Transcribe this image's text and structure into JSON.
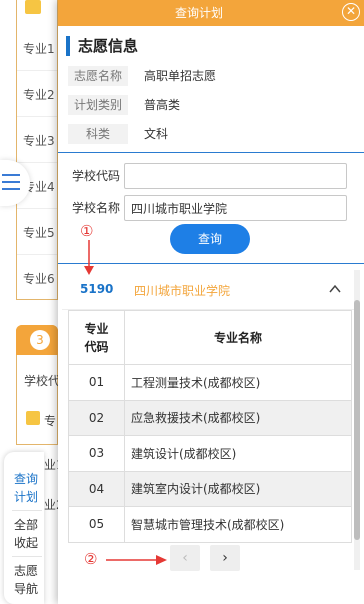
{
  "dialog": {
    "title": "查询计划"
  },
  "wish_info": {
    "section_title": "志愿信息",
    "rows": [
      {
        "label": "志愿名称",
        "value": "高职单招志愿"
      },
      {
        "label": "计划类别",
        "value": "普高类"
      },
      {
        "label": "科类",
        "value": "文科"
      }
    ]
  },
  "search": {
    "code_label": "学校代码",
    "code_value": "",
    "name_label": "学校名称",
    "name_value": "四川城市职业学院",
    "query_button": "查询"
  },
  "result": {
    "school_code": "5190",
    "school_name": "四川城市职业学院",
    "headers": [
      "专业代码",
      "专业名称"
    ],
    "rows": [
      {
        "code": "01",
        "name": "工程测量技术(成都校区)"
      },
      {
        "code": "02",
        "name": "应急救援技术(成都校区)"
      },
      {
        "code": "03",
        "name": "建筑设计(成都校区)"
      },
      {
        "code": "04",
        "name": "建筑室内设计(成都校区)"
      },
      {
        "code": "05",
        "name": "智慧城市管理技术(成都校区)"
      }
    ]
  },
  "pager": {
    "prev": "‹",
    "next": "›"
  },
  "annotations": {
    "one": "①",
    "two": "②"
  },
  "background": {
    "majors": [
      "专业1",
      "专业2",
      "专业3",
      "专业4",
      "专业5",
      "专业6"
    ],
    "card_number": "3",
    "school_label": "学校代",
    "major_label": "专",
    "partial_1": "业1",
    "partial_2": "业2"
  },
  "side_nav": {
    "items": [
      {
        "label": "查询计划"
      },
      {
        "label": "全部收起"
      },
      {
        "label": "志愿导航"
      }
    ]
  },
  "colors": {
    "accent": "#f3a53b",
    "primary": "#1e7fe6",
    "annotation": "#e53935"
  }
}
